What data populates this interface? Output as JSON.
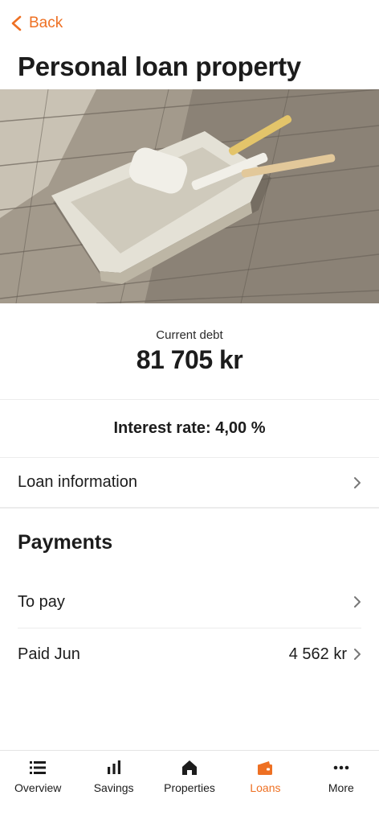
{
  "header": {
    "back_label": "Back",
    "title": "Personal loan property"
  },
  "summary": {
    "debt_label": "Current debt",
    "debt_value": "81 705 kr",
    "interest": "Interest rate: 4,00 %"
  },
  "loan_info_label": "Loan information",
  "payments": {
    "title": "Payments",
    "to_pay_label": "To pay",
    "paid_label": "Paid Jun",
    "paid_amount": "4 562 kr"
  },
  "tabs": [
    {
      "label": "Overview",
      "icon": "list-icon"
    },
    {
      "label": "Savings",
      "icon": "bar-chart-icon"
    },
    {
      "label": "Properties",
      "icon": "home-icon"
    },
    {
      "label": "Loans",
      "icon": "wallet-icon",
      "active": true
    },
    {
      "label": "More",
      "icon": "more-dots-icon"
    }
  ],
  "colors": {
    "accent": "#ee7023",
    "text": "#1c1c1c",
    "divider": "#ececec"
  }
}
